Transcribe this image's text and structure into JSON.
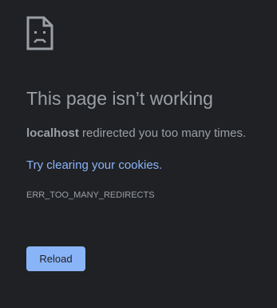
{
  "icon": "sad-page-icon",
  "heading": {
    "title": "This page isn’t working"
  },
  "summary": {
    "host": "localhost",
    "message": " redirected you too many times."
  },
  "suggestion": {
    "link_text": "Try clearing your cookies",
    "trailing": "."
  },
  "error_code": "ERR_TOO_MANY_REDIRECTS",
  "actions": {
    "reload_label": "Reload"
  },
  "colors": {
    "background": "#202124",
    "text": "#9aa0a6",
    "link": "#8ab4f8",
    "button_bg": "#8ab4f8",
    "button_text": "#202124"
  }
}
